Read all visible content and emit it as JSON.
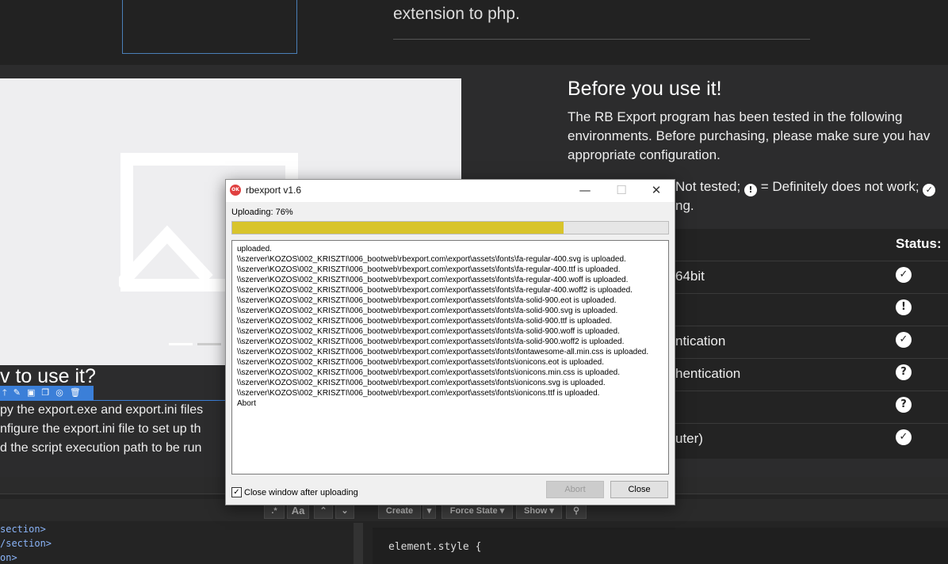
{
  "website": {
    "top_text": "extension to php.",
    "before_heading": "Before you use it!",
    "before_paragraph": [
      "The RB Export program has been tested in the following",
      "environments. Before purchasing, please make sure you hav",
      "appropriate configuration."
    ],
    "legend_line1_tail": "Not tested;",
    "legend_line1_mid": "= Definitely does not work;",
    "legend_line2_tail": "ng.",
    "table": {
      "status_header": "Status:",
      "rows": [
        {
          "text": "64bit",
          "icon": "check-circle-icon",
          "glyph": "✓"
        },
        {
          "text": "",
          "icon": "exclamation-circle-icon",
          "glyph": "!"
        },
        {
          "text": "ntication",
          "icon": "check-circle-icon",
          "glyph": "✓"
        },
        {
          "text": "hentication",
          "icon": "question-circle-icon",
          "glyph": "?"
        },
        {
          "text": "",
          "icon": "question-circle-icon",
          "glyph": "?"
        },
        {
          "text": "uter)",
          "icon": "check-circle-icon",
          "glyph": "✓"
        }
      ]
    },
    "how_heading": "v to use it?",
    "how_lines": [
      "py the export.exe and export.ini files",
      "nfigure the export.ini file to set up th",
      "d the script execution path to be run"
    ]
  },
  "devtools": {
    "buttons": {
      "aa": "Aa",
      "create": "Create",
      "force_state": "Force State",
      "show": "Show"
    },
    "code_lines": [
      "section>",
      "/section>",
      "on>"
    ],
    "style_line": "element.style {"
  },
  "dialog": {
    "title": "rbexport v1.6",
    "app_icon_text": "OK",
    "status": "Uploading: 76%",
    "progress": 0.76,
    "progress_color": "#d8c42b",
    "log_lines": [
      "uploaded.",
      "\\\\szerver\\KOZOS\\002_KRISZTI\\006_bootweb\\rbexport.com\\export\\assets\\fonts\\fa-regular-400.svg is uploaded.",
      "\\\\szerver\\KOZOS\\002_KRISZTI\\006_bootweb\\rbexport.com\\export\\assets\\fonts\\fa-regular-400.ttf is uploaded.",
      "\\\\szerver\\KOZOS\\002_KRISZTI\\006_bootweb\\rbexport.com\\export\\assets\\fonts\\fa-regular-400.woff is uploaded.",
      "\\\\szerver\\KOZOS\\002_KRISZTI\\006_bootweb\\rbexport.com\\export\\assets\\fonts\\fa-regular-400.woff2 is uploaded.",
      "\\\\szerver\\KOZOS\\002_KRISZTI\\006_bootweb\\rbexport.com\\export\\assets\\fonts\\fa-solid-900.eot is uploaded.",
      "\\\\szerver\\KOZOS\\002_KRISZTI\\006_bootweb\\rbexport.com\\export\\assets\\fonts\\fa-solid-900.svg is uploaded.",
      "\\\\szerver\\KOZOS\\002_KRISZTI\\006_bootweb\\rbexport.com\\export\\assets\\fonts\\fa-solid-900.ttf is uploaded.",
      "\\\\szerver\\KOZOS\\002_KRISZTI\\006_bootweb\\rbexport.com\\export\\assets\\fonts\\fa-solid-900.woff is uploaded.",
      "\\\\szerver\\KOZOS\\002_KRISZTI\\006_bootweb\\rbexport.com\\export\\assets\\fonts\\fa-solid-900.woff2 is uploaded.",
      "\\\\szerver\\KOZOS\\002_KRISZTI\\006_bootweb\\rbexport.com\\export\\assets\\fonts\\fontawesome-all.min.css is uploaded.",
      "\\\\szerver\\KOZOS\\002_KRISZTI\\006_bootweb\\rbexport.com\\export\\assets\\fonts\\ionicons.eot is uploaded.",
      "\\\\szerver\\KOZOS\\002_KRISZTI\\006_bootweb\\rbexport.com\\export\\assets\\fonts\\ionicons.min.css is uploaded.",
      "\\\\szerver\\KOZOS\\002_KRISZTI\\006_bootweb\\rbexport.com\\export\\assets\\fonts\\ionicons.svg is uploaded.",
      "\\\\szerver\\KOZOS\\002_KRISZTI\\006_bootweb\\rbexport.com\\export\\assets\\fonts\\ionicons.ttf is uploaded.",
      "Abort"
    ],
    "close_after_label": "Close window after uploading",
    "close_after_checked": true,
    "abort_label": "Abort",
    "close_label": "Close"
  }
}
